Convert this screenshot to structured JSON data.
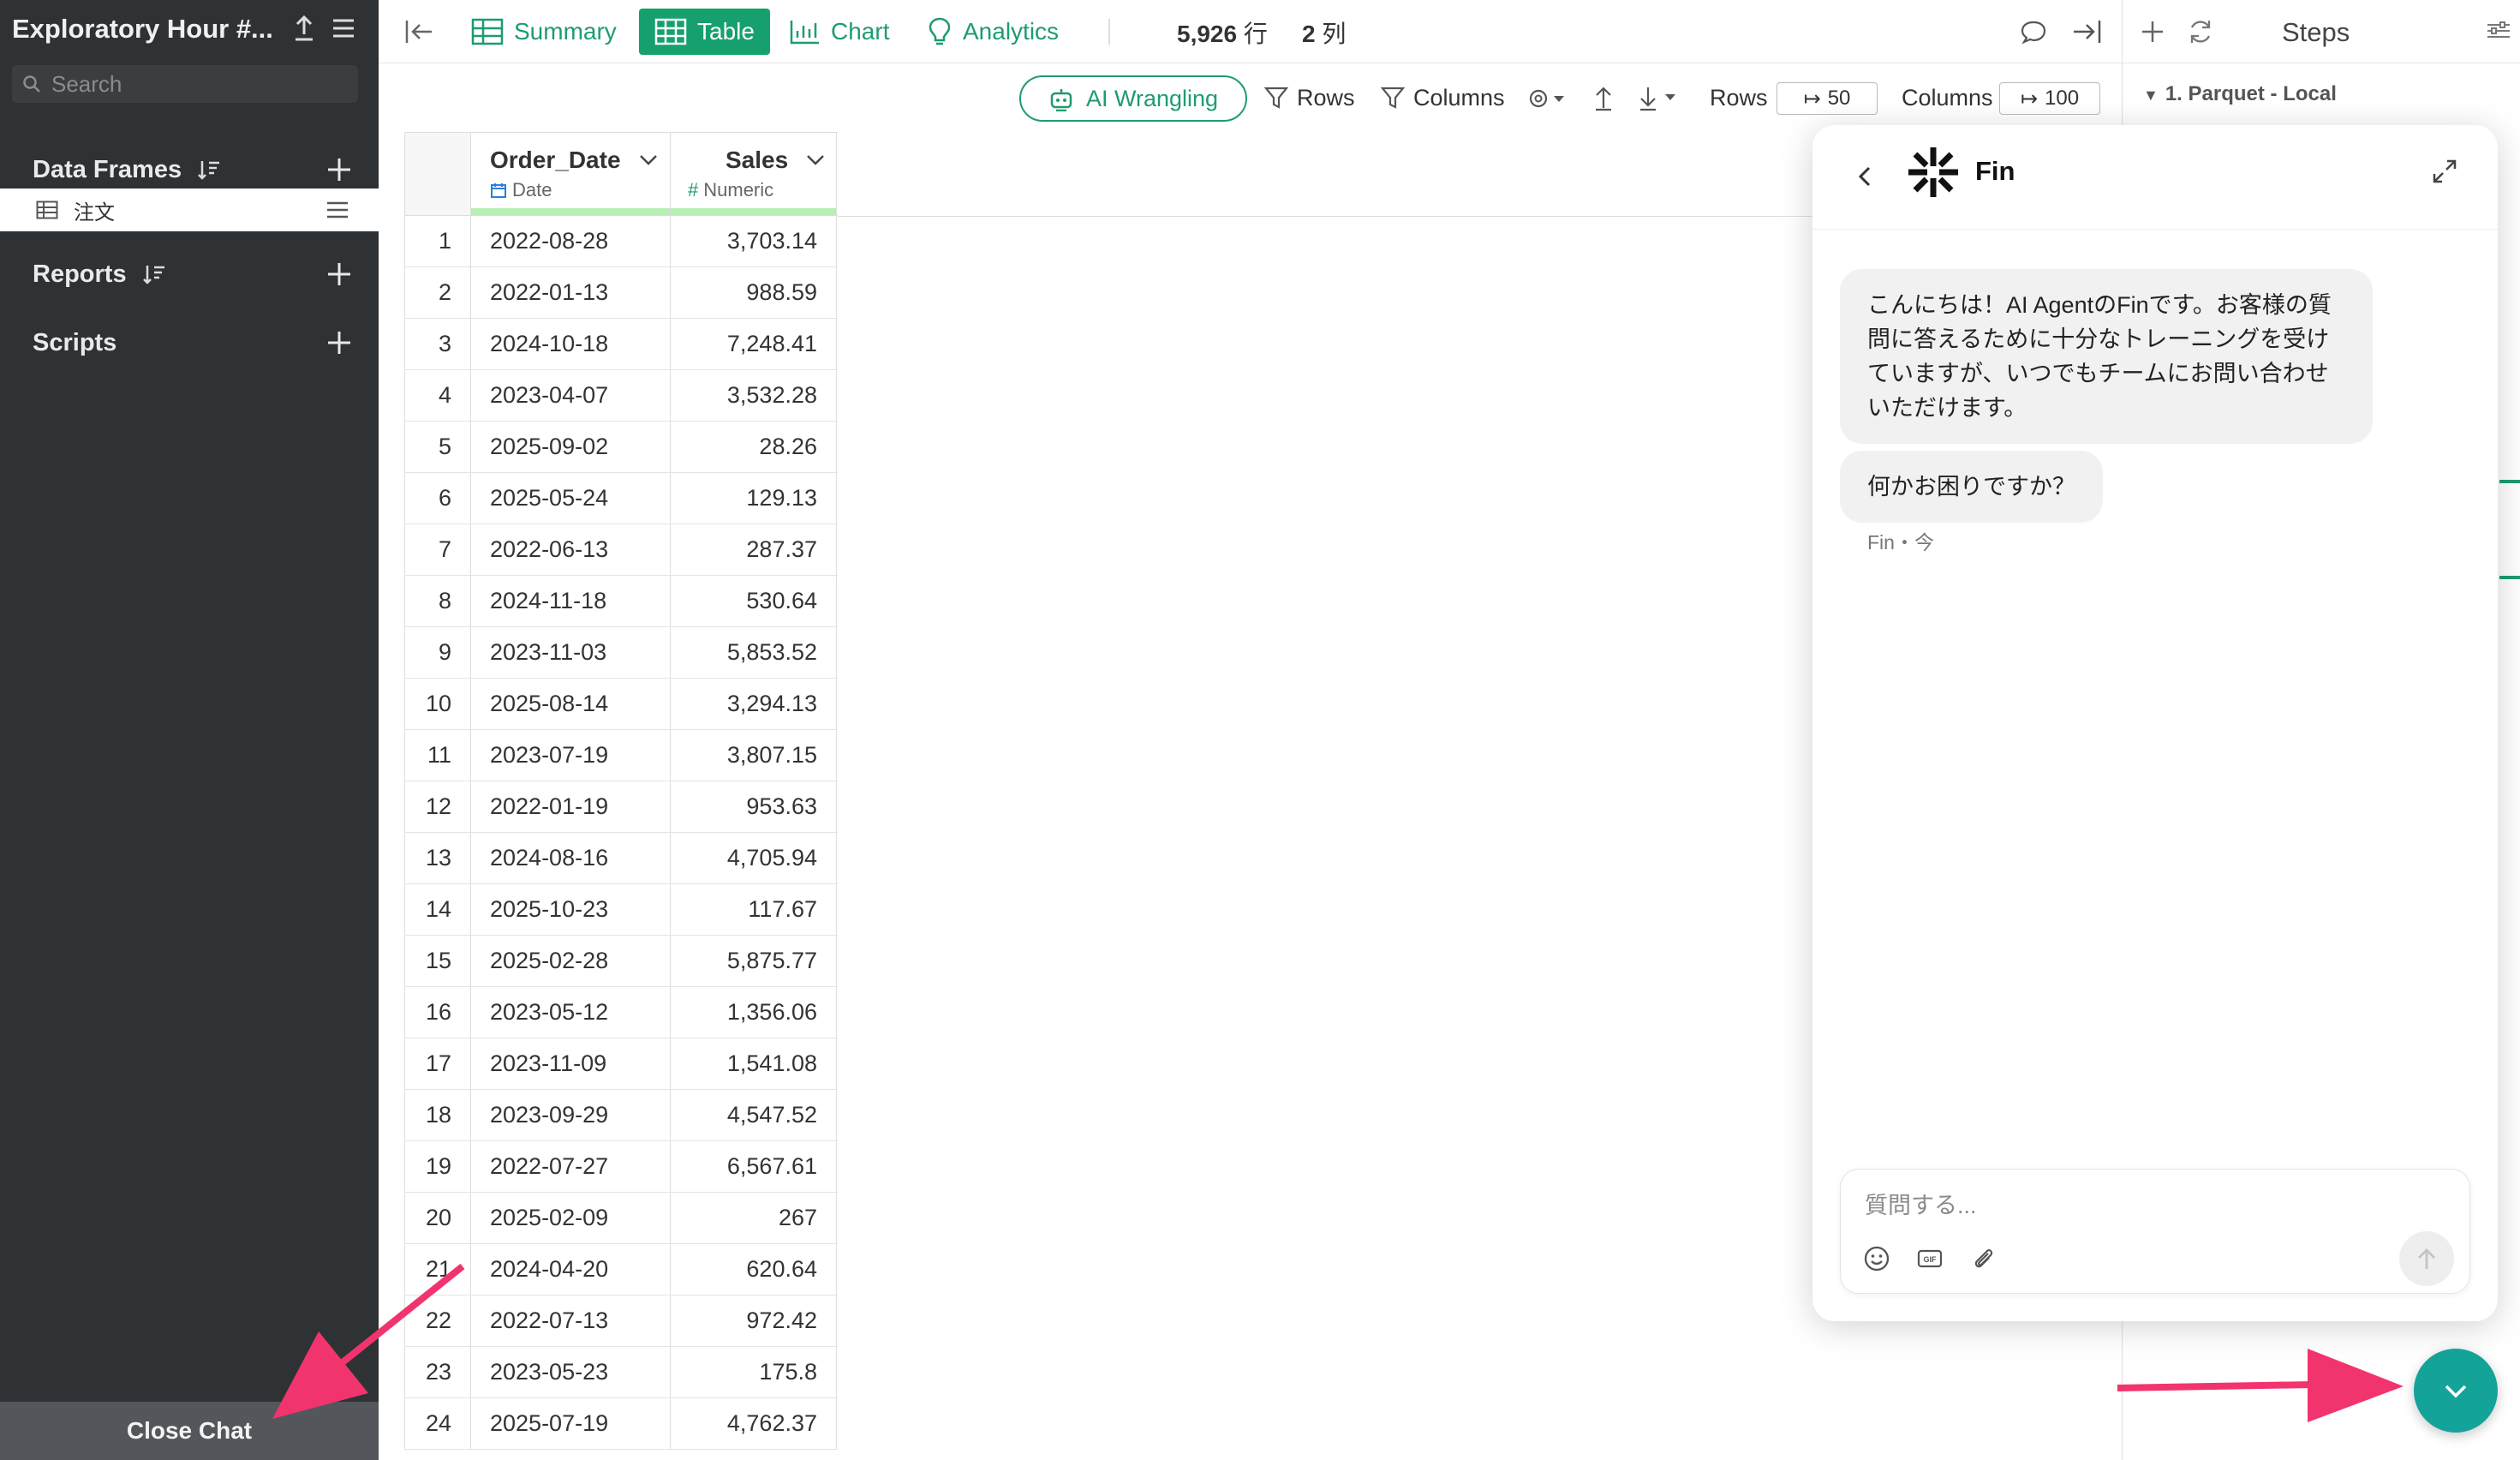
{
  "sidebar": {
    "app_title": "Exploratory Hour #...",
    "search_placeholder": "Search",
    "sections": {
      "data_frames": "Data Frames",
      "reports": "Reports",
      "scripts": "Scripts"
    },
    "data_frame_item": "注文",
    "close_chat": "Close Chat"
  },
  "toolbar": {
    "tabs": [
      "Summary",
      "Table",
      "Chart",
      "Analytics"
    ],
    "active_tab": "Table",
    "row_count": "5,926",
    "row_unit": "行",
    "col_count": "2",
    "col_unit": "列"
  },
  "subtoolbar": {
    "ai_wrangling": "AI Wrangling",
    "rows_filter": "Rows",
    "columns_filter": "Columns",
    "rows_label": "Rows",
    "rows_value": "50",
    "columns_label": "Columns",
    "columns_value": "100"
  },
  "table": {
    "columns": [
      {
        "name": "Order_Date",
        "type": "Date"
      },
      {
        "name": "Sales",
        "type": "Numeric"
      }
    ],
    "rows": [
      [
        "1",
        "2022-08-28",
        "3,703.14"
      ],
      [
        "2",
        "2022-01-13",
        "988.59"
      ],
      [
        "3",
        "2024-10-18",
        "7,248.41"
      ],
      [
        "4",
        "2023-04-07",
        "3,532.28"
      ],
      [
        "5",
        "2025-09-02",
        "28.26"
      ],
      [
        "6",
        "2025-05-24",
        "129.13"
      ],
      [
        "7",
        "2022-06-13",
        "287.37"
      ],
      [
        "8",
        "2024-11-18",
        "530.64"
      ],
      [
        "9",
        "2023-11-03",
        "5,853.52"
      ],
      [
        "10",
        "2025-08-14",
        "3,294.13"
      ],
      [
        "11",
        "2023-07-19",
        "3,807.15"
      ],
      [
        "12",
        "2022-01-19",
        "953.63"
      ],
      [
        "13",
        "2024-08-16",
        "4,705.94"
      ],
      [
        "14",
        "2025-10-23",
        "117.67"
      ],
      [
        "15",
        "2025-02-28",
        "5,875.77"
      ],
      [
        "16",
        "2023-05-12",
        "1,356.06"
      ],
      [
        "17",
        "2023-11-09",
        "1,541.08"
      ],
      [
        "18",
        "2023-09-29",
        "4,547.52"
      ],
      [
        "19",
        "2022-07-27",
        "6,567.61"
      ],
      [
        "20",
        "2025-02-09",
        "267"
      ],
      [
        "21",
        "2024-04-20",
        "620.64"
      ],
      [
        "22",
        "2022-07-13",
        "972.42"
      ],
      [
        "23",
        "2023-05-23",
        "175.8"
      ],
      [
        "24",
        "2025-07-19",
        "4,762.37"
      ]
    ]
  },
  "steps": {
    "title": "Steps",
    "step1": "1. Parquet - Local"
  },
  "chat": {
    "agent_name": "Fin",
    "message1": "こんにちは！AI AgentのFinです。お客様の質問に答えるために十分なトレーニングを受けていますが、いつでもチームにお問い合わせいただけます。",
    "message2": "何かお困りですか？",
    "meta": "Fin・今",
    "input_placeholder": "質問する...",
    "gif_label": "GIF"
  },
  "colors": {
    "accent_green": "#1e9c6e",
    "sidebar_bg": "#2f3234",
    "chat_fab": "#14a399",
    "arrow_pink": "#f2346e"
  }
}
